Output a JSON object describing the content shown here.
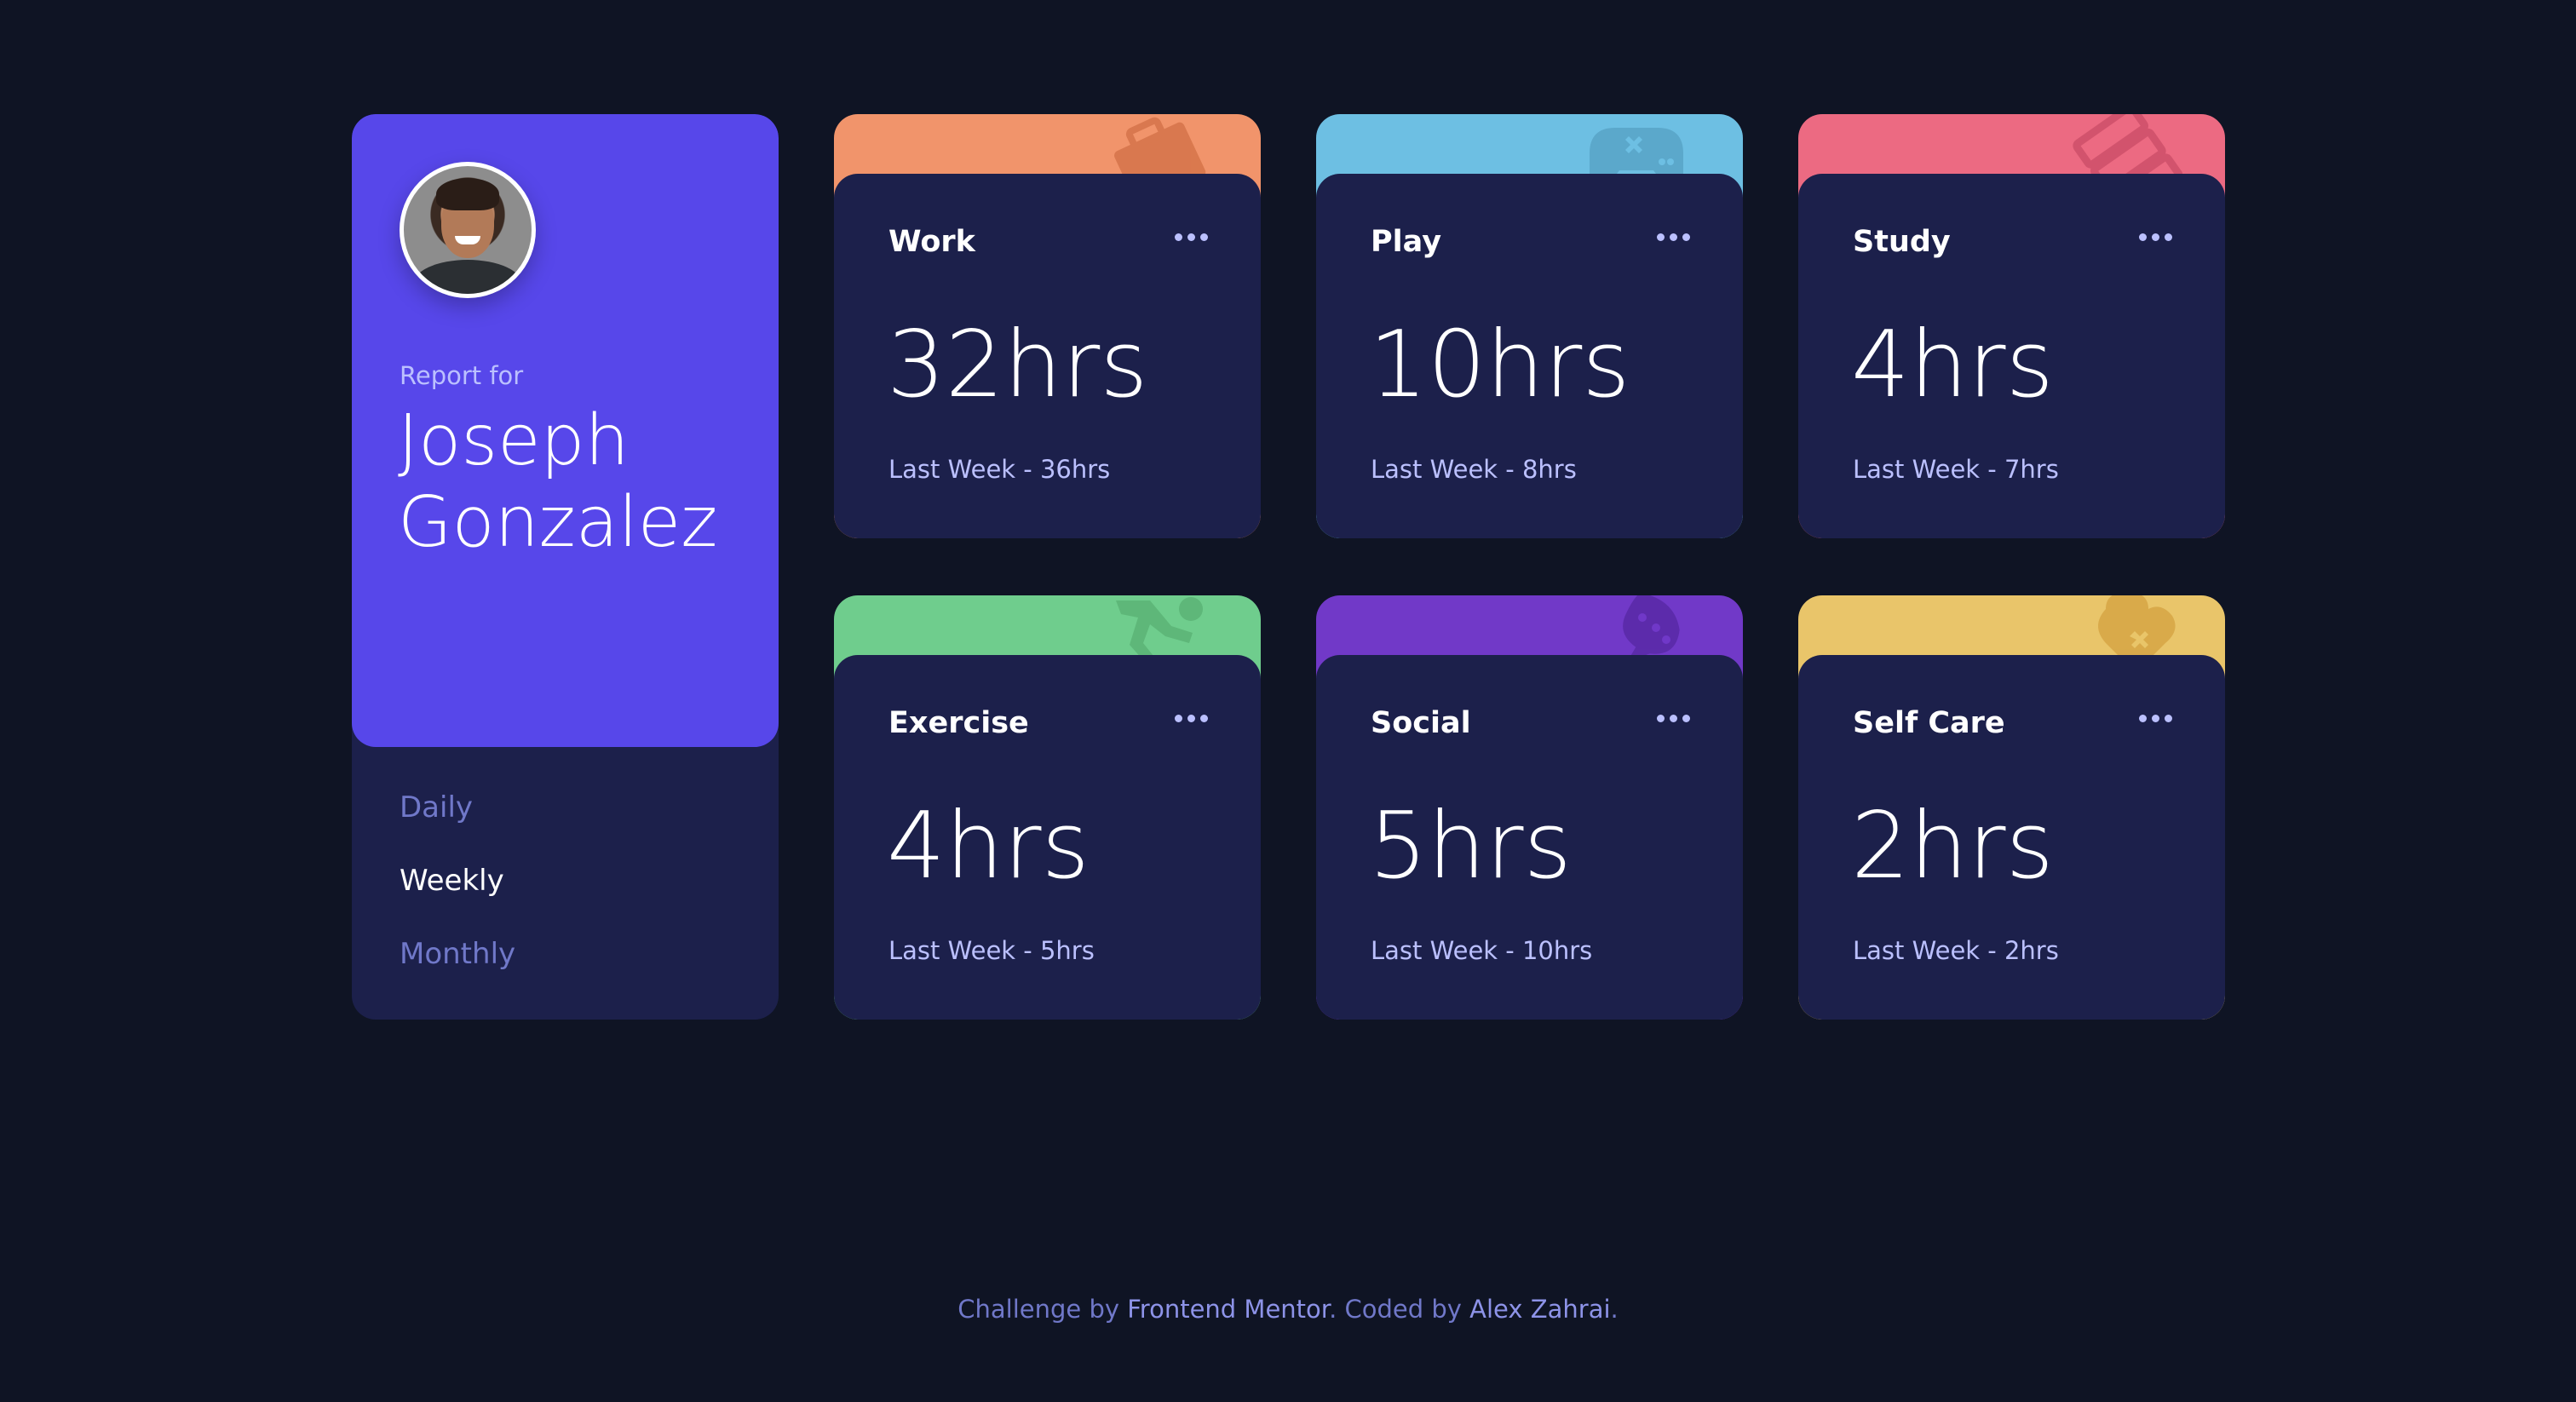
{
  "profile": {
    "report_label": "Report for",
    "first_name": "Joseph",
    "last_name": "Gonzalez",
    "periods": [
      "Daily",
      "Weekly",
      "Monthly"
    ],
    "active_period": "Weekly"
  },
  "activities": [
    {
      "title": "Work",
      "current": "32hrs",
      "previous": "Last Week - 36hrs",
      "color": "#f1946b",
      "icon": "briefcase-icon"
    },
    {
      "title": "Play",
      "current": "10hrs",
      "previous": "Last Week - 8hrs",
      "color": "#6dbfe3",
      "icon": "gamepad-icon"
    },
    {
      "title": "Study",
      "current": "4hrs",
      "previous": "Last Week - 7hrs",
      "color": "#ec6a82",
      "icon": "books-icon"
    },
    {
      "title": "Exercise",
      "current": "4hrs",
      "previous": "Last Week - 5hrs",
      "color": "#6fcd8d",
      "icon": "runner-icon"
    },
    {
      "title": "Social",
      "current": "5hrs",
      "previous": "Last Week - 10hrs",
      "color": "#7139c8",
      "icon": "chat-icon"
    },
    {
      "title": "Self Care",
      "current": "2hrs",
      "previous": "Last Week - 2hrs",
      "color": "#e9c56a",
      "icon": "heart-icon"
    }
  ],
  "footer": {
    "prefix": "Challenge by ",
    "link1": "Frontend Mentor",
    "middle": ". Coded by ",
    "link2": "Alex Zahrai",
    "suffix": "."
  }
}
